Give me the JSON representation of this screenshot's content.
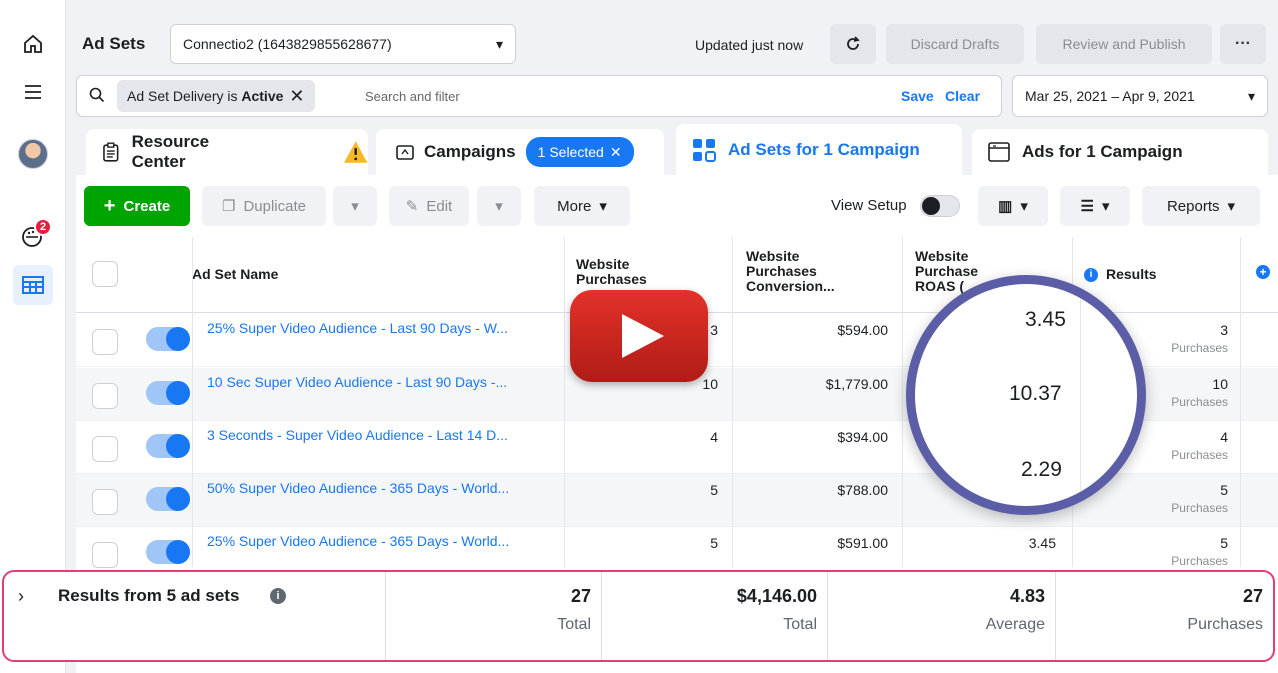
{
  "header": {
    "title": "Ad Sets",
    "account": "Connectio2 (1643829855628677)",
    "updated": "Updated just now",
    "discard_label": "Discard Drafts",
    "review_label": "Review and Publish",
    "more_dots": "···"
  },
  "rail": {
    "notification_count": "2"
  },
  "filter": {
    "chip_prefix": "Ad Set Delivery is ",
    "chip_value": "Active",
    "placeholder": "Search and filter",
    "save_label": "Save",
    "clear_label": "Clear",
    "date_range": "Mar 25, 2021 – Apr 9, 2021"
  },
  "tabs": {
    "resource": "Resource Center",
    "campaigns": "Campaigns",
    "selected_pill": "1 Selected",
    "adsets": "Ad Sets for 1 Campaign",
    "ads": "Ads for 1 Campaign"
  },
  "toolbar": {
    "create": "Create",
    "duplicate": "Duplicate",
    "edit": "Edit",
    "more": "More",
    "view_setup": "View Setup",
    "reports": "Reports"
  },
  "table": {
    "columns": {
      "name": "Ad Set Name",
      "purchases_l1": "Website",
      "purchases_l2": "Purchases",
      "conv_l1": "Website",
      "conv_l2": "Purchases",
      "conv_l3": "Conversion...",
      "roas_l1": "Website",
      "roas_l2": "Purchase",
      "roas_l3": "ROAS (",
      "results": "Results"
    },
    "rows": [
      {
        "name": "25% Super Video Audience - Last 90 Days - W...",
        "purchases": "3",
        "conv": "$594.00",
        "roas": "",
        "results": "3",
        "results_unit": "Purchases"
      },
      {
        "name": "10 Sec Super Video Audience - Last 90 Days -...",
        "purchases": "10",
        "conv": "$1,779.00",
        "roas": "",
        "results": "10",
        "results_unit": "Purchases"
      },
      {
        "name": "3 Seconds - Super Video Audience - Last 14 D...",
        "purchases": "4",
        "conv": "$394.00",
        "roas": "",
        "results": "4",
        "results_unit": "Purchases"
      },
      {
        "name": "50% Super Video Audience - 365 Days - World...",
        "purchases": "5",
        "conv": "$788.00",
        "roas": "",
        "results": "5",
        "results_unit": "Purchases"
      },
      {
        "name": "25% Super Video Audience - 365 Days - World...",
        "purchases": "5",
        "conv": "$591.00",
        "roas": "3.45",
        "results": "5",
        "results_unit": "Purchases"
      }
    ]
  },
  "footer": {
    "label": "Results from 5 ad sets",
    "purchases_total": "27",
    "purchases_sub": "Total",
    "conv_total": "$4,146.00",
    "conv_sub": "Total",
    "roas_avg": "4.83",
    "roas_sub": "Average",
    "results_total": "27",
    "results_sub": "Purchases"
  },
  "magnifier": {
    "values": [
      "3.45",
      "10.37",
      "2.29"
    ]
  },
  "colors": {
    "accent": "#1877f2",
    "create": "#00a400",
    "footer_border": "#e0407a",
    "magnifier_ring": "#5b5ea6",
    "play": "#e2322a"
  }
}
